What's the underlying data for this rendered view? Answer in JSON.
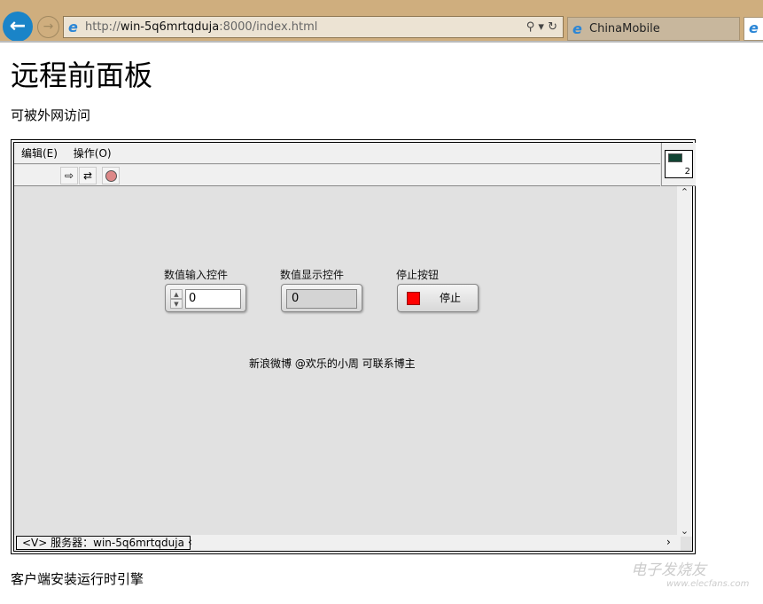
{
  "browser": {
    "url_prefix": "http://",
    "url_host": "win-5q6mrtqduja",
    "url_rest": ":8000/index.html",
    "tab_title": "ChinaMobile"
  },
  "page": {
    "heading": "远程前面板",
    "subtitle": "可被外网访问",
    "footer": "客户端安装运行时引擎"
  },
  "panel": {
    "menu": [
      "编辑(E)",
      "操作(O)"
    ],
    "vi_icon_number": "2",
    "numeric_control": {
      "label": "数值输入控件",
      "value": "0"
    },
    "numeric_indicator": {
      "label": "数值显示控件",
      "value": "0"
    },
    "stop_button": {
      "label": "停止按钮",
      "text": "停止",
      "led_color": "#ff0000"
    },
    "note": "新浪微博 @欢乐的小周 可联系博主",
    "status": "<V> 服务器：win-5q6mrtqduja"
  },
  "watermark": {
    "text": "电子发烧友",
    "url": "www.elecfans.com"
  }
}
